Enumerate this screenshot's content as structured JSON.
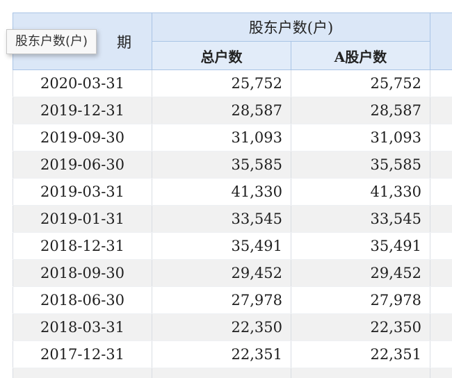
{
  "tooltip": {
    "text": "股东户数(户)"
  },
  "table": {
    "header": {
      "date_col": "期",
      "group": "股东户数(户)",
      "total": "总户数",
      "a_share": "A股户数"
    },
    "rows": [
      {
        "date": "2020-03-31",
        "total": "25,752",
        "a_share": "25,752"
      },
      {
        "date": "2019-12-31",
        "total": "28,587",
        "a_share": "28,587"
      },
      {
        "date": "2019-09-30",
        "total": "31,093",
        "a_share": "31,093"
      },
      {
        "date": "2019-06-30",
        "total": "35,585",
        "a_share": "35,585"
      },
      {
        "date": "2019-03-31",
        "total": "41,330",
        "a_share": "41,330"
      },
      {
        "date": "2019-01-31",
        "total": "33,545",
        "a_share": "33,545"
      },
      {
        "date": "2018-12-31",
        "total": "35,491",
        "a_share": "35,491"
      },
      {
        "date": "2018-09-30",
        "total": "29,452",
        "a_share": "29,452"
      },
      {
        "date": "2018-06-30",
        "total": "27,978",
        "a_share": "27,978"
      },
      {
        "date": "2018-03-31",
        "total": "22,350",
        "a_share": "22,350"
      },
      {
        "date": "2017-12-31",
        "total": "22,351",
        "a_share": "22,351"
      },
      {
        "date": "",
        "total": "",
        "a_share": ""
      }
    ]
  }
}
